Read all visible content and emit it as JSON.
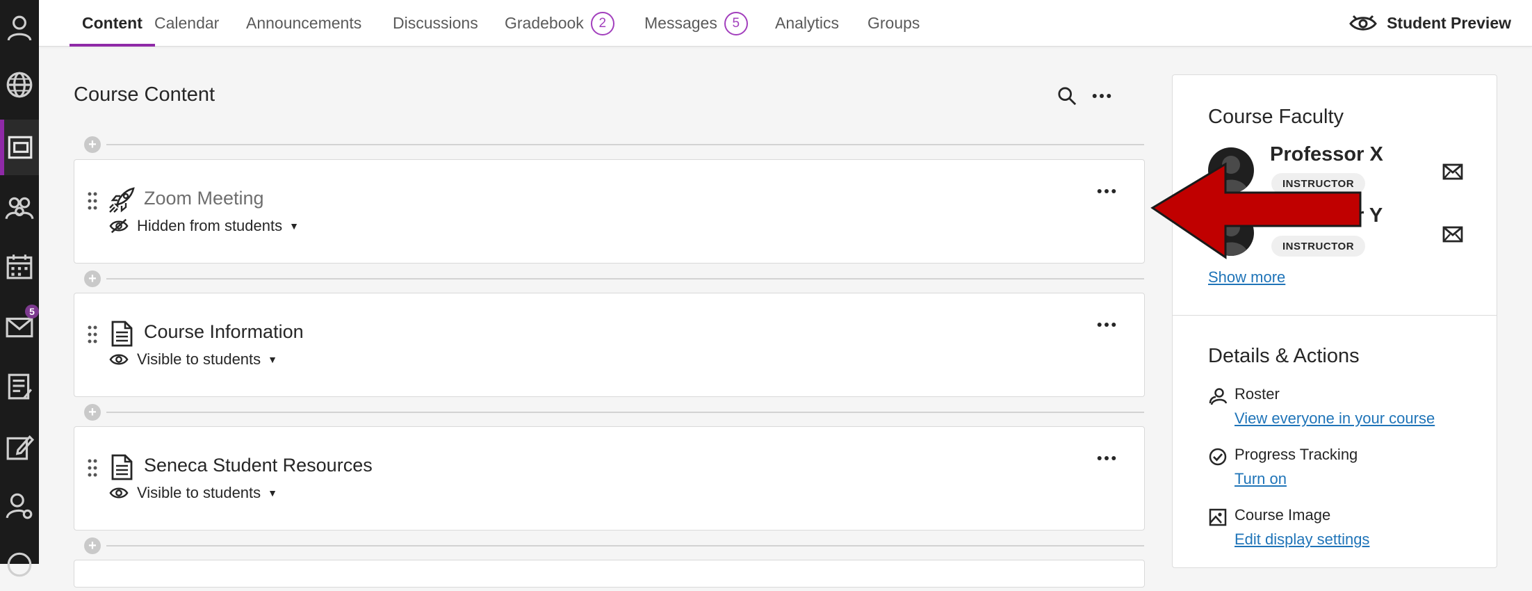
{
  "nav_rail": {
    "items": [
      {
        "name": "profile",
        "icon": "user-icon"
      },
      {
        "name": "institution",
        "icon": "globe-icon"
      },
      {
        "name": "courses",
        "icon": "courses-icon"
      },
      {
        "name": "organizations",
        "icon": "groups-icon"
      },
      {
        "name": "calendar",
        "icon": "calendar-icon"
      },
      {
        "name": "messages",
        "icon": "mail-icon",
        "badge": "5"
      },
      {
        "name": "grades",
        "icon": "grades-icon"
      },
      {
        "name": "activity",
        "icon": "edit-icon"
      },
      {
        "name": "tools",
        "icon": "user-settings-icon"
      },
      {
        "name": "history",
        "icon": "history-icon"
      }
    ]
  },
  "tabs": [
    {
      "label": "Content",
      "active": true
    },
    {
      "label": "Calendar"
    },
    {
      "label": "Announcements"
    },
    {
      "label": "Discussions"
    },
    {
      "label": "Gradebook",
      "count": "2"
    },
    {
      "label": "Messages",
      "count": "5"
    },
    {
      "label": "Analytics"
    },
    {
      "label": "Groups"
    }
  ],
  "student_preview": {
    "label": "Student Preview",
    "icon": "student-preview-icon"
  },
  "course_content": {
    "title": "Course Content",
    "items": [
      {
        "title": "Zoom Meeting",
        "icon": "rocket-icon",
        "visibility": "Hidden from students",
        "hidden": true
      },
      {
        "title": "Course Information",
        "icon": "document-icon",
        "visibility": "Visible to students",
        "hidden": false
      },
      {
        "title": "Seneca Student Resources",
        "icon": "document-icon",
        "visibility": "Visible to students",
        "hidden": false
      }
    ]
  },
  "faculty": {
    "title": "Course Faculty",
    "members": [
      {
        "name": "Professor X",
        "role": "INSTRUCTOR"
      },
      {
        "name": "Professor Y",
        "role": "INSTRUCTOR"
      }
    ],
    "show_more": "Show more"
  },
  "details": {
    "title": "Details & Actions",
    "rows": [
      {
        "label": "Roster",
        "link": "View everyone in your course",
        "icon": "roster-icon"
      },
      {
        "label": "Progress Tracking",
        "link": "Turn on",
        "icon": "check-circle-icon"
      },
      {
        "label": "Course Image",
        "link": "Edit display settings",
        "icon": "image-icon"
      }
    ]
  },
  "colors": {
    "accent": "#8f2aa7",
    "link": "#1f74b8",
    "arrow": "#c00000"
  }
}
